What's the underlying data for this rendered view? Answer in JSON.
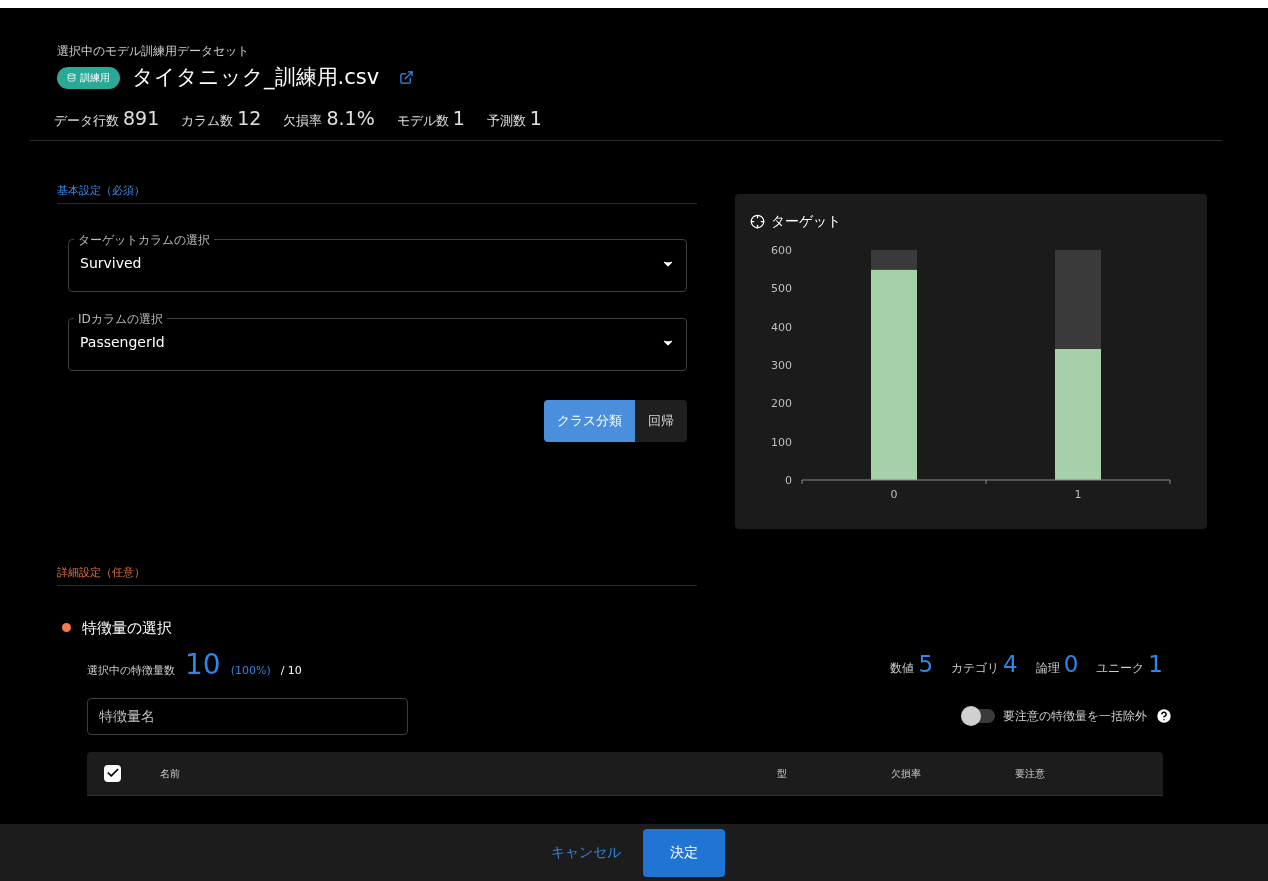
{
  "header": {
    "caption": "選択中のモデル訓練用データセット",
    "badge": "訓練用",
    "filename": "タイタニック_訓練用.csv"
  },
  "stats": [
    {
      "label": "データ行数",
      "value": "891"
    },
    {
      "label": "カラム数",
      "value": "12"
    },
    {
      "label": "欠損率",
      "value": "8.1%"
    },
    {
      "label": "モデル数",
      "value": "1"
    },
    {
      "label": "予測数",
      "value": "1"
    }
  ],
  "basic_settings": {
    "title": "基本設定（必須）",
    "selects": [
      {
        "label": "ターゲットカラムの選択",
        "value": "Survived"
      },
      {
        "label": "IDカラムの選択",
        "value": "PassengerId"
      }
    ],
    "task_types": [
      {
        "label": "クラス分類",
        "selected": true
      },
      {
        "label": "回帰",
        "selected": false
      }
    ]
  },
  "target_chart": {
    "title": "ターゲット",
    "chart_data": {
      "type": "bar",
      "categories": [
        "0",
        "1"
      ],
      "series": [
        {
          "color": "#a5d0a8",
          "values": [
            549,
            342
          ]
        },
        {
          "color": "#3a3a3a",
          "values": [
            51,
            258
          ]
        }
      ],
      "stacked": true,
      "ylim": [
        0,
        600
      ],
      "yticks": [
        0,
        100,
        200,
        300,
        400,
        500,
        600
      ]
    }
  },
  "advanced_settings": {
    "title": "詳細設定（任意）",
    "feature_selection": {
      "title": "特徴量の選択",
      "count_label": "選択中の特徴量数",
      "count": "10",
      "percent": "(100%)",
      "total": "/ 10",
      "type_counts": [
        {
          "label": "数値",
          "value": "5"
        },
        {
          "label": "カテゴリ",
          "value": "4"
        },
        {
          "label": "論理",
          "value": "0"
        },
        {
          "label": "ユニーク",
          "value": "1"
        }
      ],
      "search": {
        "placeholder": "特徴量名"
      },
      "exclude_toggle": {
        "label": "要注意の特徴量を一括除外",
        "on": false
      },
      "table": {
        "all_checked": true,
        "columns": [
          "名前",
          "型",
          "欠損率",
          "要注意"
        ]
      }
    }
  },
  "footer": {
    "buttons": [
      {
        "label": "キャンセル",
        "kind": "text"
      },
      {
        "label": "決定",
        "kind": "primary"
      }
    ]
  }
}
